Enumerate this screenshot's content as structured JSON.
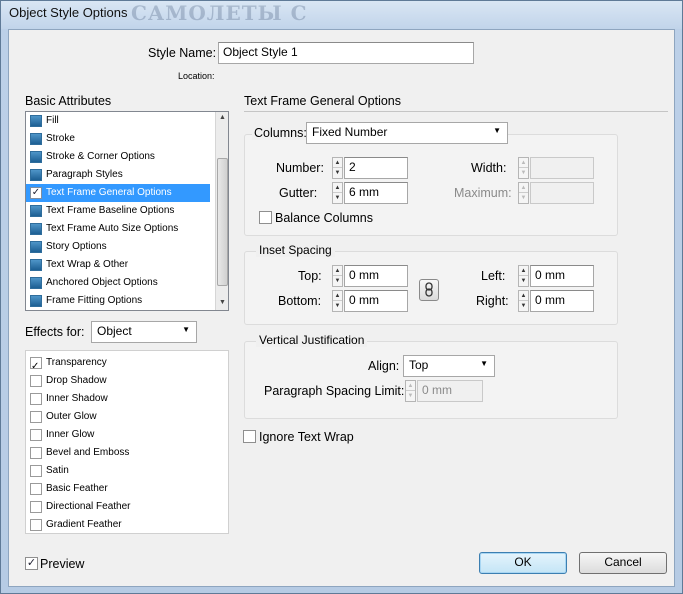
{
  "window": {
    "title": "Object Style Options",
    "background_text": "САМОЛЕТЫ С"
  },
  "style_name": {
    "label": "Style Name:",
    "value": "Object Style 1",
    "location_label": "Location:"
  },
  "basic_attributes": {
    "heading": "Basic Attributes",
    "items": [
      {
        "label": "Fill",
        "checked": true
      },
      {
        "label": "Stroke",
        "checked": true
      },
      {
        "label": "Stroke & Corner Options",
        "checked": true
      },
      {
        "label": "Paragraph Styles",
        "checked": true
      },
      {
        "label": "Text Frame General Options",
        "checked": true,
        "selected": true
      },
      {
        "label": "Text Frame Baseline Options",
        "checked": true
      },
      {
        "label": "Text Frame Auto Size Options",
        "checked": true
      },
      {
        "label": "Story Options",
        "checked": true
      },
      {
        "label": "Text Wrap & Other",
        "checked": true
      },
      {
        "label": "Anchored Object Options",
        "checked": true
      },
      {
        "label": "Frame Fitting Options",
        "checked": true
      }
    ]
  },
  "effects_for": {
    "label": "Effects for:",
    "value": "Object"
  },
  "effects": {
    "items": [
      {
        "label": "Transparency",
        "checked": true
      },
      {
        "label": "Drop Shadow",
        "checked": false
      },
      {
        "label": "Inner Shadow",
        "checked": false
      },
      {
        "label": "Outer Glow",
        "checked": false
      },
      {
        "label": "Inner Glow",
        "checked": false
      },
      {
        "label": "Bevel and Emboss",
        "checked": false
      },
      {
        "label": "Satin",
        "checked": false
      },
      {
        "label": "Basic Feather",
        "checked": false
      },
      {
        "label": "Directional Feather",
        "checked": false
      },
      {
        "label": "Gradient Feather",
        "checked": false
      }
    ]
  },
  "panel": {
    "heading": "Text Frame General Options",
    "columns": {
      "label": "Columns:",
      "value": "Fixed Number"
    },
    "number": {
      "label": "Number:",
      "value": "2"
    },
    "gutter": {
      "label": "Gutter:",
      "value": "6 mm"
    },
    "width": {
      "label": "Width:",
      "value": ""
    },
    "maximum": {
      "label": "Maximum:",
      "value": ""
    },
    "balance_columns": {
      "label": "Balance Columns",
      "checked": false
    },
    "inset_spacing": {
      "title": "Inset Spacing",
      "top": {
        "label": "Top:",
        "value": "0 mm"
      },
      "bottom": {
        "label": "Bottom:",
        "value": "0 mm"
      },
      "left": {
        "label": "Left:",
        "value": "0 mm"
      },
      "right": {
        "label": "Right:",
        "value": "0 mm"
      }
    },
    "vertical_justification": {
      "title": "Vertical Justification",
      "align": {
        "label": "Align:",
        "value": "Top"
      },
      "paragraph_spacing_limit": {
        "label": "Paragraph Spacing Limit:",
        "value": "0 mm"
      }
    },
    "ignore_text_wrap": {
      "label": "Ignore Text Wrap",
      "checked": false
    }
  },
  "footer": {
    "preview": {
      "label": "Preview",
      "checked": true
    },
    "ok_label": "OK",
    "cancel_label": "Cancel"
  }
}
